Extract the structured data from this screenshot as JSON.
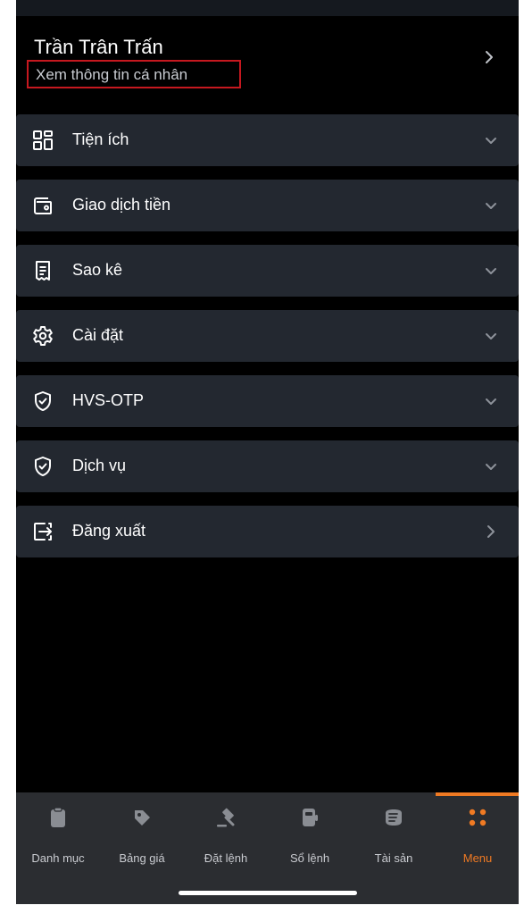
{
  "profile": {
    "name": "Trần Trân Trấn",
    "view_info": "Xem thông tin cá nhân"
  },
  "menu": {
    "items": [
      {
        "label": "Tiện ích",
        "icon": "grid-icon",
        "action": "chevron-down-icon"
      },
      {
        "label": "Giao dịch tiền",
        "icon": "wallet-icon",
        "action": "chevron-down-icon"
      },
      {
        "label": "Sao kê",
        "icon": "receipt-icon",
        "action": "chevron-down-icon"
      },
      {
        "label": "Cài đặt",
        "icon": "gear-icon",
        "action": "chevron-down-icon"
      },
      {
        "label": "HVS-OTP",
        "icon": "shield-check-icon",
        "action": "chevron-down-icon"
      },
      {
        "label": "Dịch vụ",
        "icon": "shield-check-icon",
        "action": "chevron-down-icon"
      },
      {
        "label": "Đăng xuất",
        "icon": "logout-icon",
        "action": "chevron-right-icon"
      }
    ]
  },
  "bottom_nav": {
    "items": [
      {
        "label": "Danh mục",
        "icon": "clipboard-icon",
        "active": false
      },
      {
        "label": "Bảng giá",
        "icon": "price-tag-icon",
        "active": false
      },
      {
        "label": "Đặt lệnh",
        "icon": "gavel-icon",
        "active": false
      },
      {
        "label": "Sổ lệnh",
        "icon": "order-book-icon",
        "active": false
      },
      {
        "label": "Tài sản",
        "icon": "assets-icon",
        "active": false
      },
      {
        "label": "Menu",
        "icon": "menu-dots-icon",
        "active": true
      }
    ]
  },
  "colors": {
    "background": "#000000",
    "card": "#232830",
    "accent": "#f07a23",
    "highlight_border": "#c6181f",
    "bottom_nav": "#2b2d31"
  }
}
